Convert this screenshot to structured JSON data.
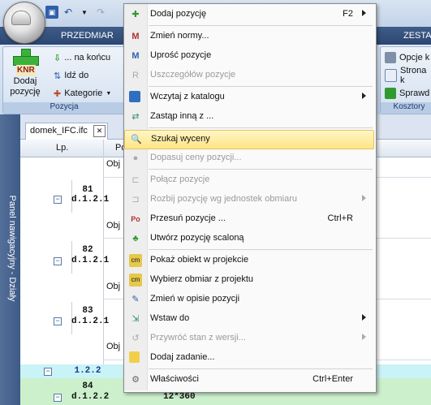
{
  "ribbon": {
    "tabs": [
      "PRZEDMIAR",
      "ZESTA"
    ],
    "groups": {
      "pozycja": {
        "label": "Pozycja",
        "dodaj_pozycje": "Dodaj\npozycję",
        "knr_badge": "KNR",
        "na_koncu": "... na końcu",
        "idz_do": "Idź do",
        "kategorie": "Kategorie"
      },
      "koszty": {
        "label": "Kosztory",
        "items": [
          "Opcje k",
          "Strona k",
          "Sprawd"
        ]
      }
    }
  },
  "nav_panel": {
    "label": "Panel nawigacyjny - Działy"
  },
  "document": {
    "tab": "domek_IFC.ifc",
    "close": "✕",
    "grid": {
      "headers": {
        "lp": "Lp.",
        "po": "Po"
      },
      "rows": [
        {
          "obj": "Obj"
        },
        {
          "num": "81",
          "code": "d.1.2.1"
        },
        {
          "obj": "Obj"
        },
        {
          "num": "82",
          "code": "d.1.2.1"
        },
        {
          "obj": "Obj"
        },
        {
          "num": "83",
          "code": "d.1.2.1"
        },
        {
          "obj": "Obj"
        },
        {
          "code": "1.2.2"
        },
        {
          "num": "84",
          "code": "d.1.2.2",
          "value": "12*360"
        }
      ]
    }
  },
  "context_menu": {
    "items": [
      {
        "label": "Dodaj pozycję",
        "shortcut": "F2",
        "submenu": true,
        "disabled": false,
        "icon": "knr-add-icon"
      },
      {
        "label": "Zmień normy...",
        "disabled": false,
        "icon": "change-norms-icon"
      },
      {
        "label": "Uprość pozycje",
        "disabled": false,
        "icon": "simplify-icon"
      },
      {
        "label": "Uszczegółów pozycje",
        "disabled": true,
        "icon": "detail-icon"
      },
      {
        "label": "Wczytaj z katalogu",
        "submenu": true,
        "disabled": false,
        "icon": "catalog-icon"
      },
      {
        "label": "Zastąp inną z ...",
        "disabled": false,
        "icon": "replace-icon"
      },
      {
        "label": "Szukaj wyceny",
        "disabled": false,
        "highlighted": true,
        "icon": "search-price-icon"
      },
      {
        "label": "Dopasuj ceny pozycji...",
        "disabled": true,
        "icon": "match-prices-icon"
      },
      {
        "label": "Połącz pozycje",
        "disabled": true,
        "icon": "merge-icon"
      },
      {
        "label": "Rozbij pozycję wg jednostek obmiaru",
        "submenu": true,
        "disabled": true,
        "icon": "split-icon"
      },
      {
        "label": "Przesuń pozycje ...",
        "shortcut": "Ctrl+R",
        "disabled": false,
        "icon": "move-icon"
      },
      {
        "label": "Utwórz pozycję scaloną",
        "disabled": false,
        "icon": "merged-position-icon"
      },
      {
        "label": "Pokaż obiekt w projekcie",
        "disabled": false,
        "icon": "show-object-icon"
      },
      {
        "label": "Wybierz obmiar z projektu",
        "disabled": false,
        "icon": "pick-measure-icon"
      },
      {
        "label": "Zmień w opisie pozycji",
        "disabled": false,
        "icon": "edit-description-icon"
      },
      {
        "label": "Wstaw do",
        "submenu": true,
        "disabled": false,
        "icon": "insert-icon"
      },
      {
        "label": "Przywróć stan z wersji...",
        "submenu": true,
        "disabled": true,
        "icon": "restore-icon"
      },
      {
        "label": "Dodaj zadanie...",
        "disabled": false,
        "icon": "task-icon"
      },
      {
        "label": "Właściwości",
        "shortcut": "Ctrl+Enter",
        "disabled": false,
        "icon": "properties-icon"
      }
    ]
  }
}
